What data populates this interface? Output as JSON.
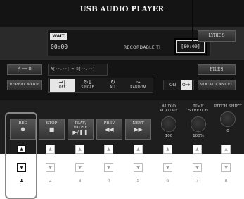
{
  "title": "USB AUDIO PLAYER",
  "status": {
    "wait": "WAIT",
    "time": "00:00",
    "recordable_label": "RECORDABLE TI",
    "recordable_value": "[80:00]"
  },
  "buttons": {
    "lyrics": "LYRICS",
    "files": "FILES",
    "vocal_cancel": "VOCAL CANCEL",
    "ab": "A ⟷ B",
    "repeat_mode": "REPEAT MODE"
  },
  "ab_range": "A[--:--] ⇔ B[--:--]",
  "repeat_modes": [
    {
      "label": "OFF",
      "icon": "→|",
      "selected": true
    },
    {
      "label": "SINGLE",
      "icon": "↻1",
      "selected": false
    },
    {
      "label": "ALL",
      "icon": "↻",
      "selected": false
    },
    {
      "label": "RANDOM",
      "icon": "⤳",
      "selected": false
    }
  ],
  "vocal_toggle": {
    "on": "ON",
    "off": "OFF"
  },
  "transport": [
    {
      "label": "REC",
      "glyph": "●"
    },
    {
      "label": "STOP",
      "glyph": "■"
    },
    {
      "label": "PLAY/ PAUSE",
      "glyph": "▶/❚❚"
    },
    {
      "label": "PREV",
      "glyph": "◀◀"
    },
    {
      "label": "NEXT",
      "glyph": "▶▶"
    }
  ],
  "knobs": [
    {
      "label": "AUDIO VOLUME",
      "value": "100"
    },
    {
      "label": "TIME STRETCH",
      "value": "100%"
    },
    {
      "label": "PITCH SHIFT",
      "value": "0"
    }
  ],
  "hardware_numbers": [
    "1",
    "2",
    "3",
    "4",
    "5",
    "6",
    "7",
    "8"
  ],
  "hardware_up_glyph": "▲",
  "hardware_down_glyph": "▼",
  "colors": {
    "screen_bg": "#141414",
    "button_face": "#3a3a3a",
    "selected": "#e6e6e6",
    "highlight_frame": "#000000",
    "callout_frame": "#888888"
  }
}
